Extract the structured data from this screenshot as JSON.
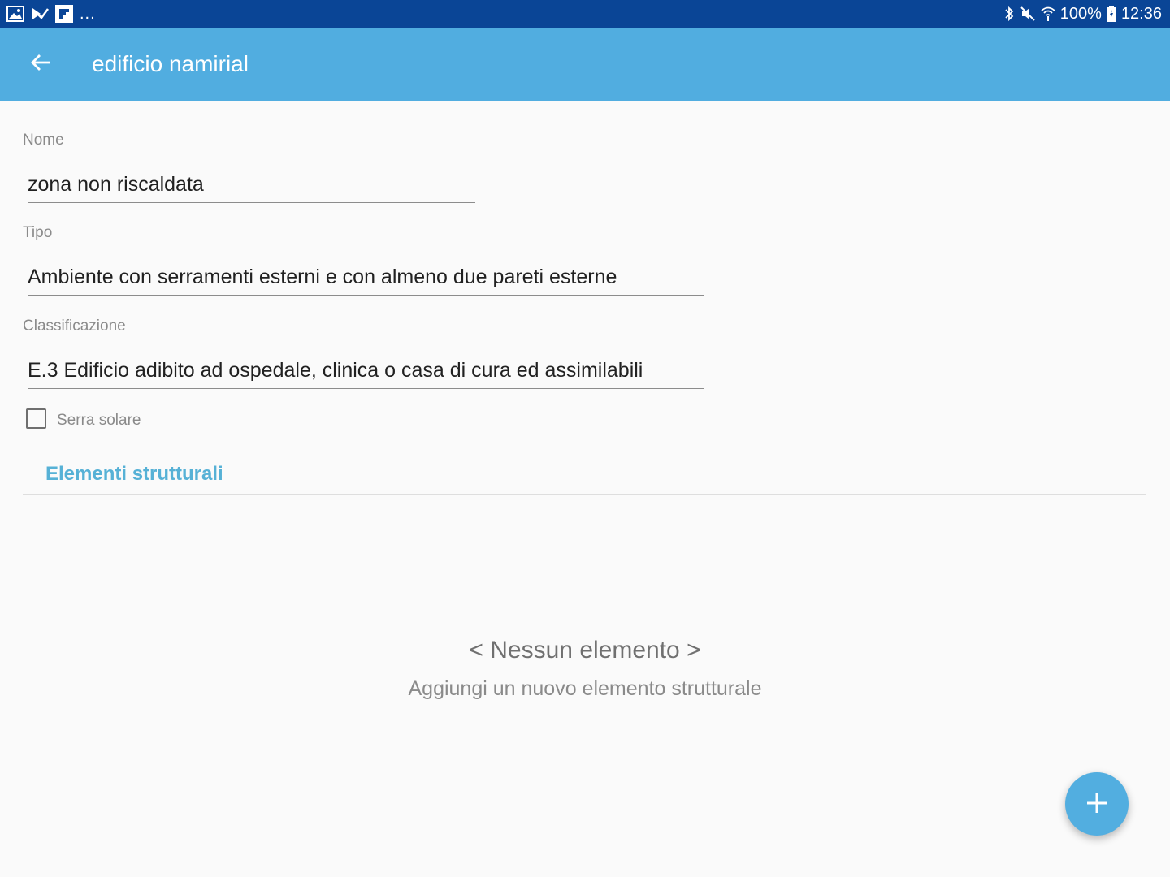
{
  "status_bar": {
    "left_icons": [
      "gallery-icon",
      "task-icon",
      "flipboard-icon"
    ],
    "more_indicator": "...",
    "right_icons": [
      "bluetooth-icon",
      "mute-icon",
      "wifi-icon",
      "battery-icon"
    ],
    "battery": "100%",
    "time": "12:36"
  },
  "app_bar": {
    "back_icon": "arrow-back-icon",
    "title": "edificio namirial"
  },
  "form": {
    "nome": {
      "label": "Nome",
      "value": "zona non riscaldata"
    },
    "tipo": {
      "label": "Tipo",
      "value": "Ambiente con serramenti esterni e con almeno due pareti esterne"
    },
    "classificazione": {
      "label": "Classificazione",
      "value": "E.3 Edificio adibito ad ospedale, clinica o casa di cura ed assimilabili"
    },
    "serra_solare": {
      "label": "Serra solare",
      "checked": false
    }
  },
  "section": {
    "title": "Elementi strutturali"
  },
  "empty_state": {
    "title": "< Nessun elemento >",
    "subtitle": "Aggiungi un nuovo elemento strutturale"
  },
  "fab": {
    "icon": "plus-icon",
    "color": "#52aee0"
  },
  "colors": {
    "status_bar": "#0a4596",
    "app_bar": "#51ade0",
    "accent": "#56b1d6"
  }
}
